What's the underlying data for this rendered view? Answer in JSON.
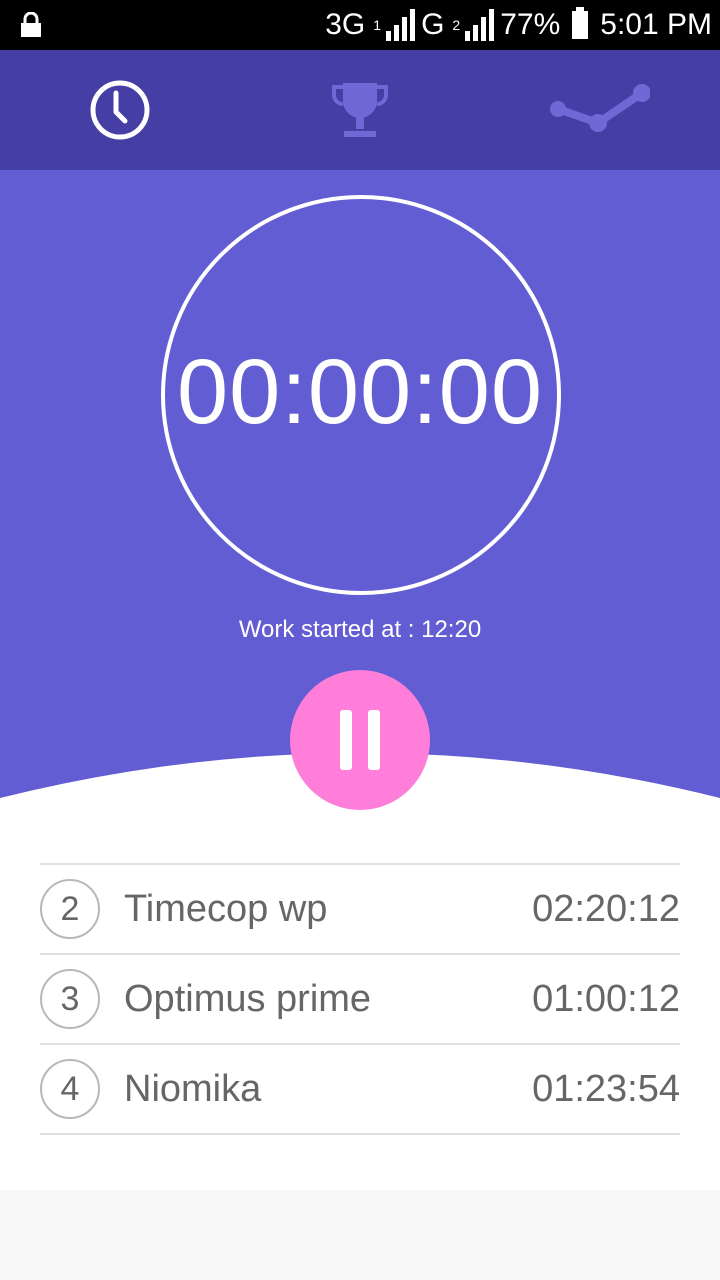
{
  "status": {
    "network1": "3G",
    "sim1": "1",
    "network2": "G",
    "sim2": "2",
    "battery": "77%",
    "clock": "5:01 PM"
  },
  "tabs": [
    {
      "icon": "clock-icon",
      "active": true
    },
    {
      "icon": "trophy-icon",
      "active": false
    },
    {
      "icon": "chart-line-icon",
      "active": false
    }
  ],
  "timer": {
    "display": "00:00:00",
    "started_label": "Work started at : 12:20"
  },
  "colors": {
    "tab_bar": "#443ea5",
    "hero": "#625dd2",
    "pause_button": "#ff7ed9"
  },
  "leaderboard": [
    {
      "rank": "2",
      "name": "Timecop wp",
      "time": "02:20:12"
    },
    {
      "rank": "3",
      "name": "Optimus prime",
      "time": "01:00:12"
    },
    {
      "rank": "4",
      "name": "Niomika",
      "time": "01:23:54"
    }
  ]
}
